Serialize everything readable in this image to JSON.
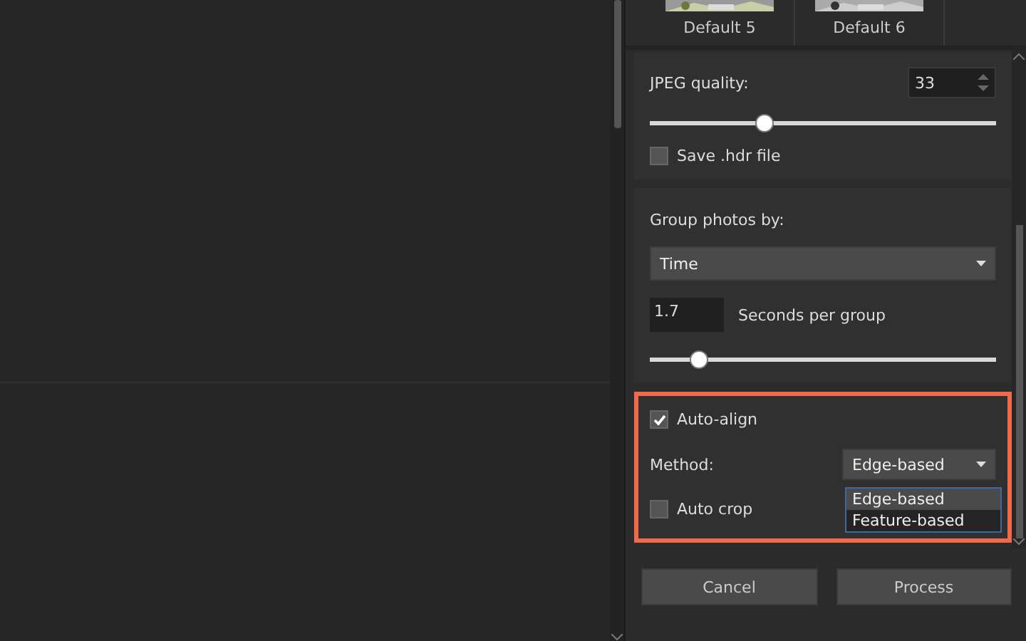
{
  "presets": [
    {
      "label": "Default 5"
    },
    {
      "label": "Default 6"
    }
  ],
  "jpeg": {
    "label": "JPEG quality:",
    "value": "33",
    "level": 0.33,
    "save_hdr": {
      "label": "Save .hdr file",
      "checked": false
    }
  },
  "grouping": {
    "label": "Group photos by:",
    "mode": "Time",
    "seconds": "1.7",
    "seconds_label": "Seconds per group",
    "level": 0.14
  },
  "alignment": {
    "highlighted": true,
    "auto_align": {
      "label": "Auto-align",
      "checked": true
    },
    "method_label": "Method:",
    "method": "Edge-based",
    "menu_open": true,
    "options": [
      {
        "label": "Edge-based",
        "selected": true
      },
      {
        "label": "Feature-based",
        "selected": false
      }
    ],
    "auto_crop": {
      "label": "Auto crop",
      "checked": false
    }
  },
  "buttons": [
    {
      "label": "Cancel"
    },
    {
      "label": "Process"
    }
  ]
}
